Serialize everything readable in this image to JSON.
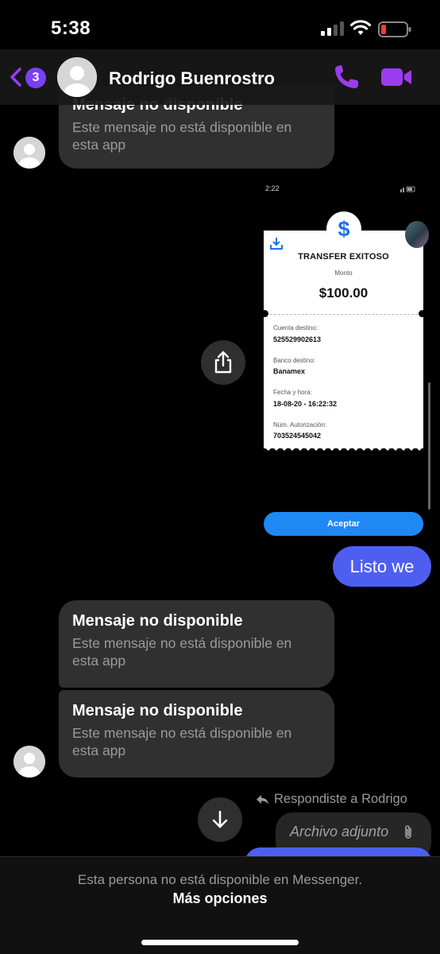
{
  "status_bar": {
    "time": "5:38"
  },
  "header": {
    "unread_count": "3",
    "contact_name": "Rodrigo Buenrostro",
    "accent_color": "#9b3cf0"
  },
  "messages": {
    "top_clipped": {
      "title": "Mensaje no disponible",
      "text": "Este mensaje no está disponible en esta app"
    },
    "receipt_image": {
      "time": "2:22",
      "title": "TRANSFER EXITOSO",
      "monto_label": "Monto",
      "amount": "$100.00",
      "cuenta_label": "Cuenta destino:",
      "cuenta_value": "525529902613",
      "banco_label": "Banco destino:",
      "banco_value": "Banamex",
      "fecha_label": "Fecha y hora:",
      "fecha_value": "18-08-20 - 16:22:32",
      "autorizacion_label": "Núm. Autorización:",
      "autorizacion_value": "703524545042",
      "button_label": "Aceptar"
    },
    "outgoing_text": "Listo we",
    "unavailable_1": {
      "title": "Mensaje no disponible",
      "text": "Este mensaje no está disponible en esta app"
    },
    "unavailable_2": {
      "title": "Mensaje no disponible",
      "text": "Este mensaje no está disponible en esta app"
    },
    "replied_label": "Respondiste a Rodrigo",
    "attachment_label": "Archivo adjunto"
  },
  "footer": {
    "note": "Esta persona no está disponible en Messenger.",
    "more_options": "Más opciones"
  },
  "colors": {
    "outgoing_bubble": "#4e5ff0",
    "incoming_bubble": "#303030",
    "receipt_accent": "#1e88f5"
  }
}
